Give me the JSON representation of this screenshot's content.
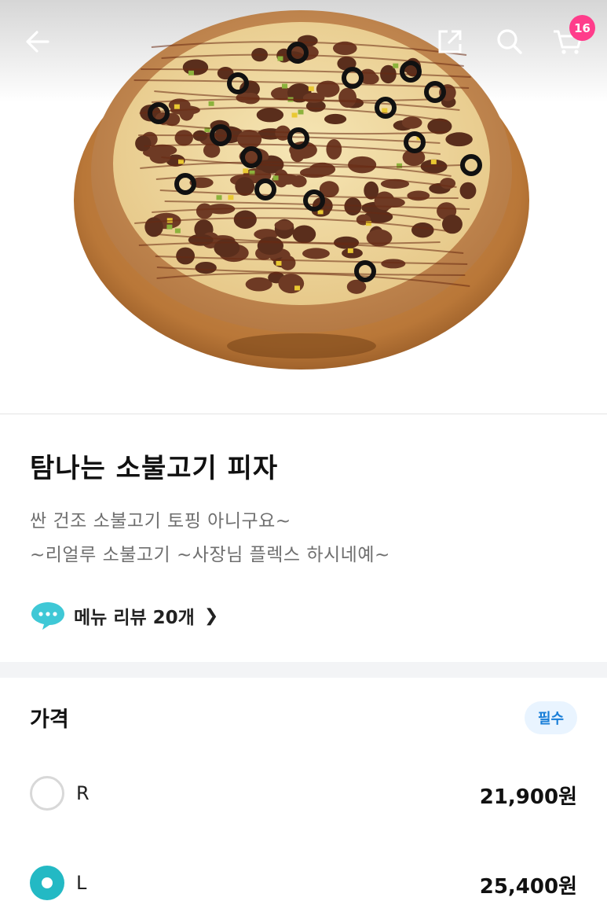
{
  "header": {
    "cart_count": "16",
    "icons": [
      "arrow-left-icon",
      "share-icon",
      "search-icon",
      "cart-icon"
    ]
  },
  "product": {
    "name": "탐나는 소불고기 피자",
    "description_line1": "싼 건조 소불고기 토핑 아니구요~",
    "description_line2": "~리얼루 소불고기 ~사장님 플렉스 하시네예~",
    "review_link": "메뉴 리뷰 20개"
  },
  "price_section": {
    "title": "가격",
    "required_badge": "필수",
    "options": [
      {
        "label": "R",
        "price": "21,900원",
        "selected": false
      },
      {
        "label": "L",
        "price": "25,400원",
        "selected": true
      }
    ]
  },
  "colors": {
    "accent": "#23b9c4",
    "badge": "#ff3d8b",
    "required_text": "#1a7fd8",
    "required_bg": "#e9f4ff"
  }
}
